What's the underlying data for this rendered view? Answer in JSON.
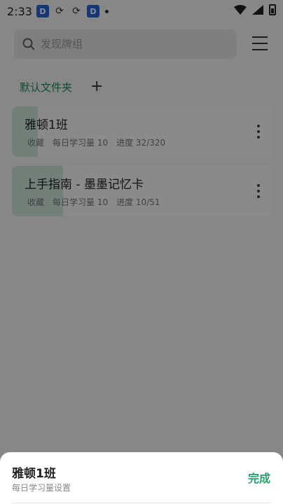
{
  "status_bar": {
    "time": "2:33",
    "icon_d": "D"
  },
  "search": {
    "placeholder": "发现牌组"
  },
  "folders": {
    "current": "默认文件夹",
    "add_label": "+"
  },
  "decks": [
    {
      "title": "雅顿1班",
      "fav": "收藏",
      "daily": "每日学习量 10",
      "progress": "进度 32/320",
      "progress_fraction": 0.1
    },
    {
      "title": "上手指南 - 墨墨记忆卡",
      "fav": "收藏",
      "daily": "每日学习量 10",
      "progress": "进度 10/51",
      "progress_fraction": 0.196
    }
  ],
  "sheet": {
    "title": "雅顿1班",
    "subtitle": "每日学习量设置",
    "done_label": "完成"
  },
  "colors": {
    "accent": "#27a06b",
    "progress_fill": "#cfe9dc"
  }
}
